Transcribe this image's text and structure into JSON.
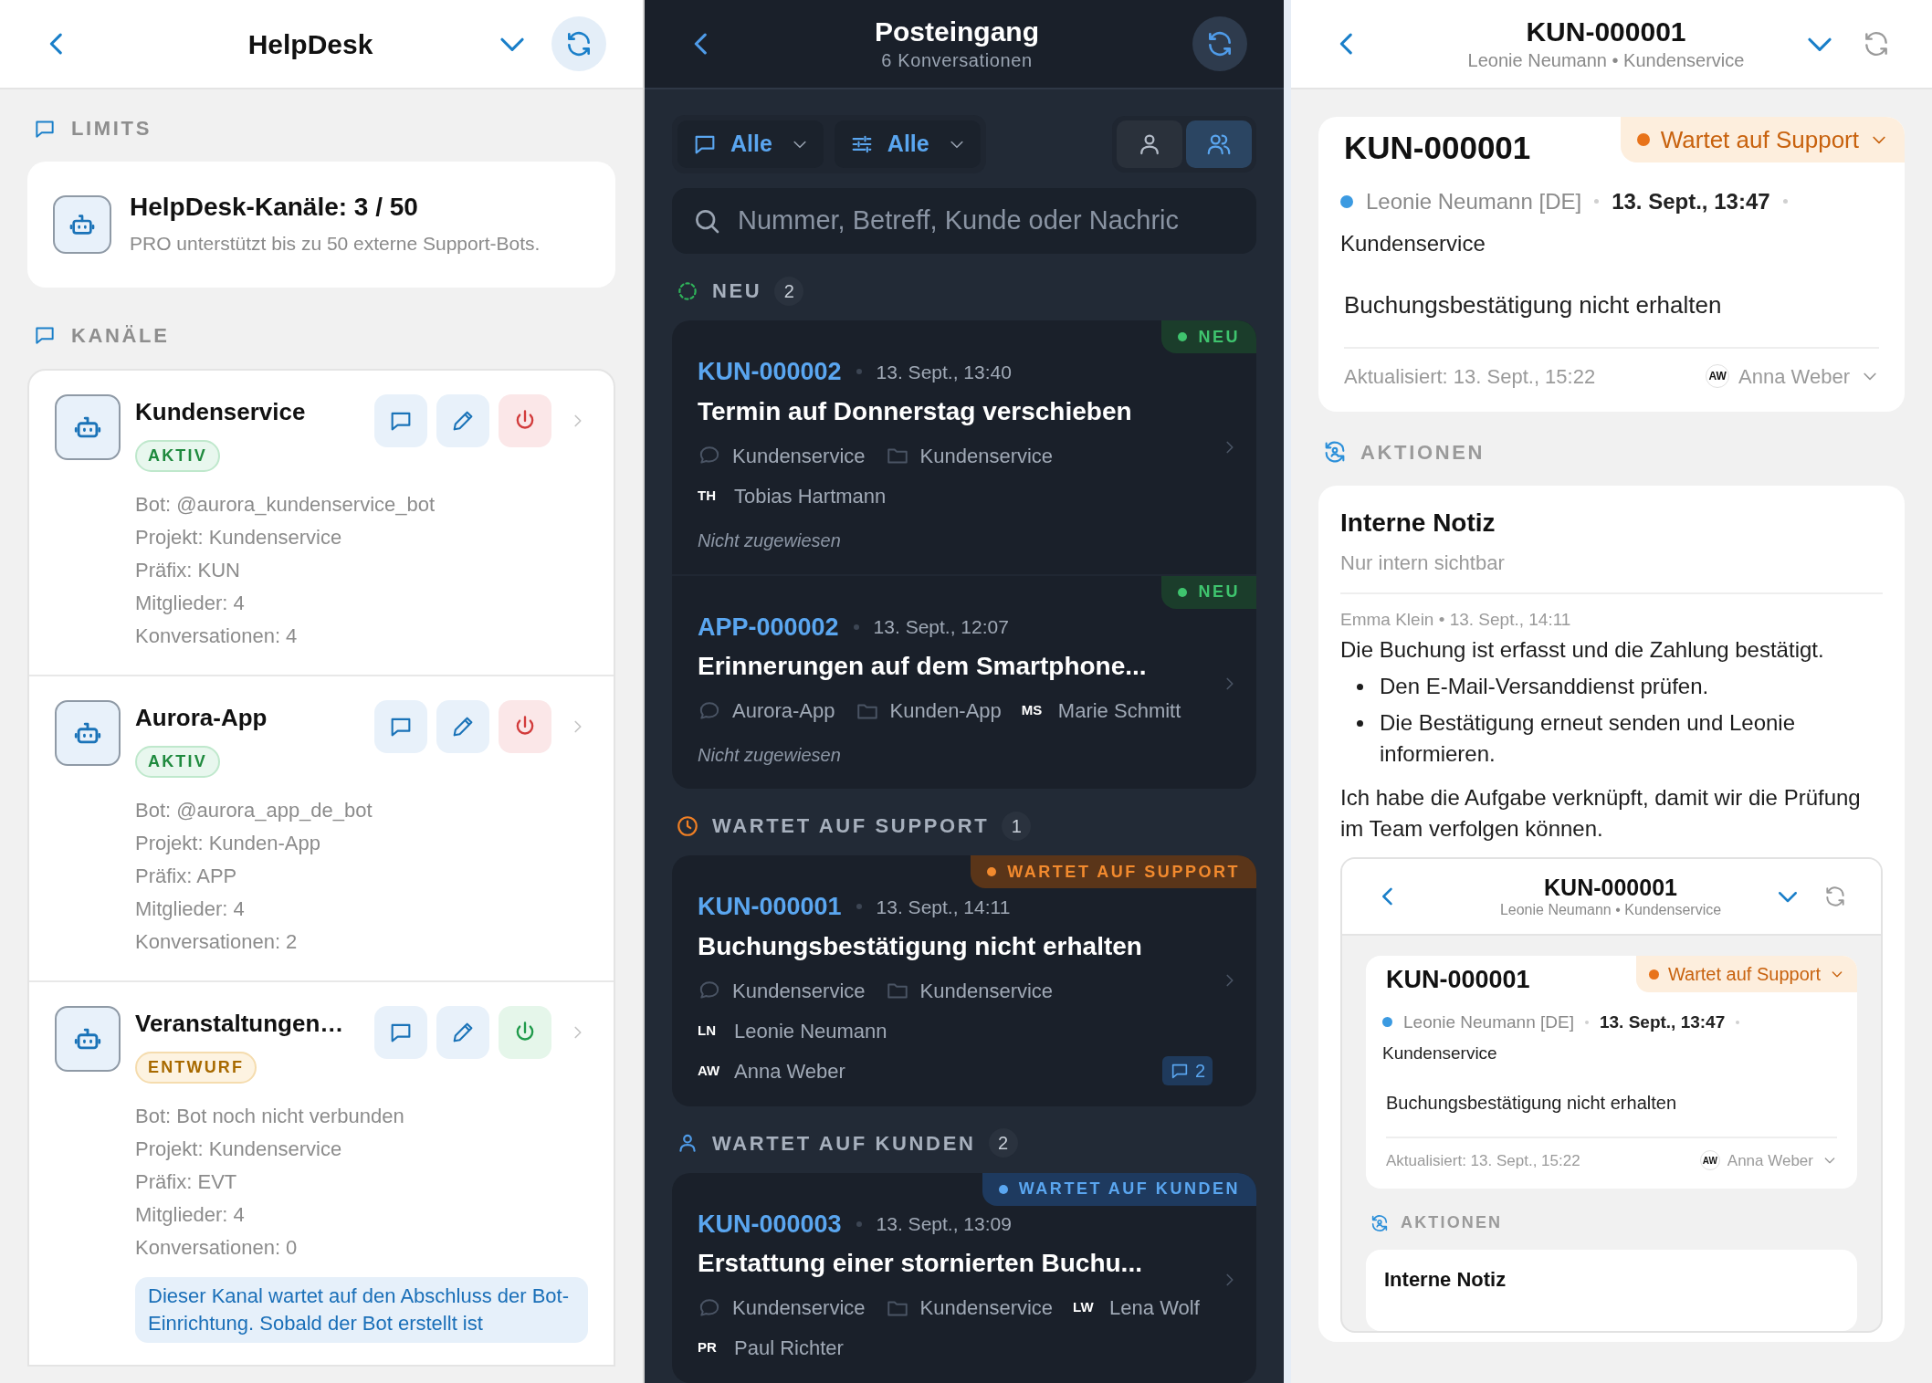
{
  "channels_screen": {
    "header": {
      "title": "HelpDesk"
    },
    "limits": {
      "label": "LIMITS",
      "title": "HelpDesk-Kanäle: 3 / 50",
      "text": "PRO unterstützt bis zu 50 externe Support-Bots."
    },
    "channels_label": "KANÄLE",
    "channels": [
      {
        "name": "Kundenservice",
        "status": {
          "kind": "active",
          "label": "AKTIV"
        },
        "details": [
          "Bot: @aurora_kundenservice_bot",
          "Projekt: Kundenservice",
          "Präfix: KUN",
          "Mitglieder: 4",
          "Konversationen: 4"
        ]
      },
      {
        "name": "Aurora-App",
        "status": {
          "kind": "active",
          "label": "AKTIV"
        },
        "details": [
          "Bot: @aurora_app_de_bot",
          "Projekt: Kunden-App",
          "Präfix: APP",
          "Mitglieder: 4",
          "Konversationen: 2"
        ]
      },
      {
        "name": "Veranstaltungen…",
        "status": {
          "kind": "draft",
          "label": "ENTWURF"
        },
        "details": [
          "Bot: Bot noch nicht verbunden",
          "Projekt: Kundenservice",
          "Präfix: EVT",
          "Mitglieder: 4",
          "Konversationen: 0"
        ],
        "notice": "Dieser Kanal wartet auf den Abschluss der Bot-Einrichtung. Sobald der Bot erstellt ist"
      }
    ]
  },
  "inbox_screen": {
    "header": {
      "title": "Posteingang",
      "subtitle": "6 Konversationen"
    },
    "filters": [
      {
        "kind": "channel",
        "label": "Alle"
      },
      {
        "kind": "filter",
        "label": "Alle"
      }
    ],
    "view_modes": [
      {
        "kind": "mine",
        "selected": false
      },
      {
        "kind": "team",
        "selected": true
      }
    ],
    "search": {
      "placeholder": "Nummer, Betreff, Kunde oder Nachric"
    },
    "groups": [
      {
        "kind": "new",
        "label": "NEU",
        "count": "2",
        "conversations": [
          {
            "number": "KUN-000002",
            "time": "13. Sept., 13:40",
            "subject": "Termin auf Donnerstag verschieben",
            "badge": {
              "kind": "new",
              "label": "NEU"
            },
            "lines": [
              [
                {
                  "kind": "channel",
                  "text": "Kundenservice"
                },
                {
                  "kind": "project",
                  "text": "Kundenservice"
                }
              ],
              [
                {
                  "kind": "person",
                  "initials": "TH",
                  "name": "Tobias Hartmann"
                }
              ],
              [
                {
                  "kind": "unassigned",
                  "text": "Nicht zugewiesen"
                }
              ]
            ]
          },
          {
            "number": "APP-000002",
            "time": "13. Sept., 12:07",
            "subject": "Erinnerungen auf dem Smartphone...",
            "badge": {
              "kind": "new",
              "label": "NEU"
            },
            "lines": [
              [
                {
                  "kind": "channel",
                  "text": "Aurora-App"
                },
                {
                  "kind": "project",
                  "text": "Kunden-App"
                },
                {
                  "kind": "person",
                  "initials": "MS",
                  "name": "Marie Schmitt"
                }
              ],
              [
                {
                  "kind": "unassigned",
                  "text": "Nicht zugewiesen"
                }
              ]
            ]
          }
        ]
      },
      {
        "kind": "support",
        "label": "WARTET AUF SUPPORT",
        "count": "1",
        "conversations": [
          {
            "number": "KUN-000001",
            "time": "13. Sept., 14:11",
            "subject": "Buchungsbestätigung nicht erhalten",
            "badge": {
              "kind": "support",
              "label": "WARTET AUF SUPPORT"
            },
            "lines": [
              [
                {
                  "kind": "channel",
                  "text": "Kundenservice"
                },
                {
                  "kind": "project",
                  "text": "Kundenservice"
                }
              ],
              [
                {
                  "kind": "person",
                  "initials": "LN",
                  "name": "Leonie Neumann"
                }
              ],
              [
                {
                  "kind": "person",
                  "initials": "AW",
                  "name": "Anna Weber"
                },
                {
                  "kind": "messages",
                  "text": "2"
                }
              ]
            ]
          }
        ]
      },
      {
        "kind": "customer",
        "label": "WARTET AUF KUNDEN",
        "count": "2",
        "conversations": [
          {
            "number": "KUN-000003",
            "time": "13. Sept., 13:09",
            "subject": "Erstattung einer stornierten Buchu...",
            "badge": {
              "kind": "customer",
              "label": "WARTET AUF KUNDEN"
            },
            "lines": [
              [
                {
                  "kind": "channel",
                  "text": "Kundenservice"
                },
                {
                  "kind": "project",
                  "text": "Kundenservice"
                },
                {
                  "kind": "person",
                  "initials": "LW",
                  "name": "Lena Wolf"
                }
              ],
              [
                {
                  "kind": "person",
                  "initials": "PR",
                  "name": "Paul Richter"
                }
              ]
            ]
          }
        ]
      }
    ]
  },
  "ticket_screen": {
    "header": {
      "title": "KUN-000001",
      "subtitle": "Leonie Neumann • Kundenservice"
    },
    "ticket": {
      "number": "KUN-000001",
      "status": "Wartet auf Support",
      "customer": {
        "name": "Leonie Neumann [DE]",
        "color": "#3b9ae1"
      },
      "time": "13. Sept., 13:47",
      "channel": "Kundenservice",
      "subject": "Buchungsbestätigung nicht erhalten",
      "updated": "Aktualisiert: 13. Sept., 15:22",
      "assignee": {
        "initials": "AW",
        "name": "Anna Weber"
      }
    },
    "actions_label": "AKTIONEN",
    "note": {
      "title": "Interne Notiz",
      "subtitle": "Nur intern sichtbar",
      "author": "Emma Klein • 13. Sept., 14:11",
      "intro": "Die Buchung ist erfasst und die Zahlung bestätigt.",
      "bullets": [
        "Den E-Mail-Versanddienst prüfen.",
        "Die Bestätigung erneut senden und Leonie informieren."
      ],
      "outro": "Ich habe die Aufgabe verknüpft, damit wir die Prüfung im Team verfolgen können.",
      "embedded_screenshot": {
        "header": {
          "title": "KUN-000001",
          "subtitle": "Leonie Neumann • Kundenservice"
        },
        "ticket": {
          "number": "KUN-000001",
          "status": "Wartet auf Support",
          "customer": {
            "name": "Leonie Neumann [DE]",
            "color": "#3b9ae1"
          },
          "time": "13. Sept., 13:47",
          "channel": "Kundenservice",
          "subject": "Buchungsbestätigung nicht erhalten",
          "updated": "Aktualisiert: 13. Sept., 15:22",
          "assignee": {
            "initials": "AW",
            "name": "Anna Weber"
          }
        },
        "actions_label": "AKTIONEN",
        "note_title": "Interne Notiz"
      }
    }
  }
}
